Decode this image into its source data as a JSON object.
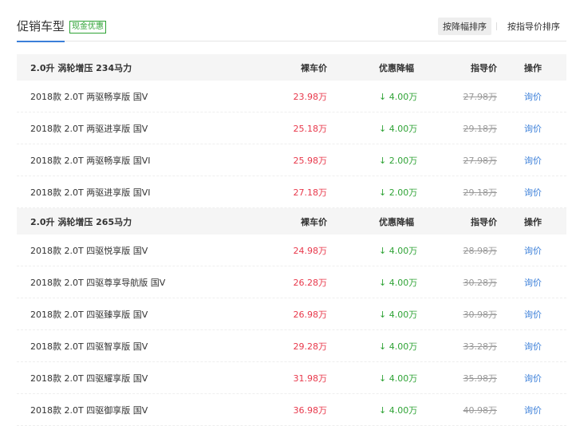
{
  "header": {
    "title": "促销车型",
    "badge": "现金优惠",
    "sort_by_discount": "按降幅排序",
    "sort_by_guide": "按指导价排序"
  },
  "columns": {
    "price": "裸车价",
    "discount": "优惠降幅",
    "guide": "指导价",
    "action": "操作"
  },
  "groups": [
    {
      "title": "2.0升 涡轮增压 234马力",
      "rows": [
        {
          "name": "2018款 2.0T 两驱畅享版 国V",
          "price": "23.98万",
          "discount": "↓ 4.00万",
          "guide": "27.98万",
          "action": "询价"
        },
        {
          "name": "2018款 2.0T 两驱进享版 国V",
          "price": "25.18万",
          "discount": "↓ 4.00万",
          "guide": "29.18万",
          "action": "询价"
        },
        {
          "name": "2018款 2.0T 两驱畅享版 国VI",
          "price": "25.98万",
          "discount": "↓ 2.00万",
          "guide": "27.98万",
          "action": "询价"
        },
        {
          "name": "2018款 2.0T 两驱进享版 国VI",
          "price": "27.18万",
          "discount": "↓ 2.00万",
          "guide": "29.18万",
          "action": "询价"
        }
      ]
    },
    {
      "title": "2.0升 涡轮增压 265马力",
      "rows": [
        {
          "name": "2018款 2.0T 四驱悦享版 国V",
          "price": "24.98万",
          "discount": "↓ 4.00万",
          "guide": "28.98万",
          "action": "询价"
        },
        {
          "name": "2018款 2.0T 四驱尊享导航版 国V",
          "price": "26.28万",
          "discount": "↓ 4.00万",
          "guide": "30.28万",
          "action": "询价"
        },
        {
          "name": "2018款 2.0T 四驱臻享版 国V",
          "price": "26.98万",
          "discount": "↓ 4.00万",
          "guide": "30.98万",
          "action": "询价"
        },
        {
          "name": "2018款 2.0T 四驱智享版 国V",
          "price": "29.28万",
          "discount": "↓ 4.00万",
          "guide": "33.28万",
          "action": "询价"
        },
        {
          "name": "2018款 2.0T 四驱耀享版 国V",
          "price": "31.98万",
          "discount": "↓ 4.00万",
          "guide": "35.98万",
          "action": "询价"
        },
        {
          "name": "2018款 2.0T 四驱御享版 国V",
          "price": "36.98万",
          "discount": "↓ 4.00万",
          "guide": "40.98万",
          "action": "询价"
        }
      ]
    }
  ]
}
